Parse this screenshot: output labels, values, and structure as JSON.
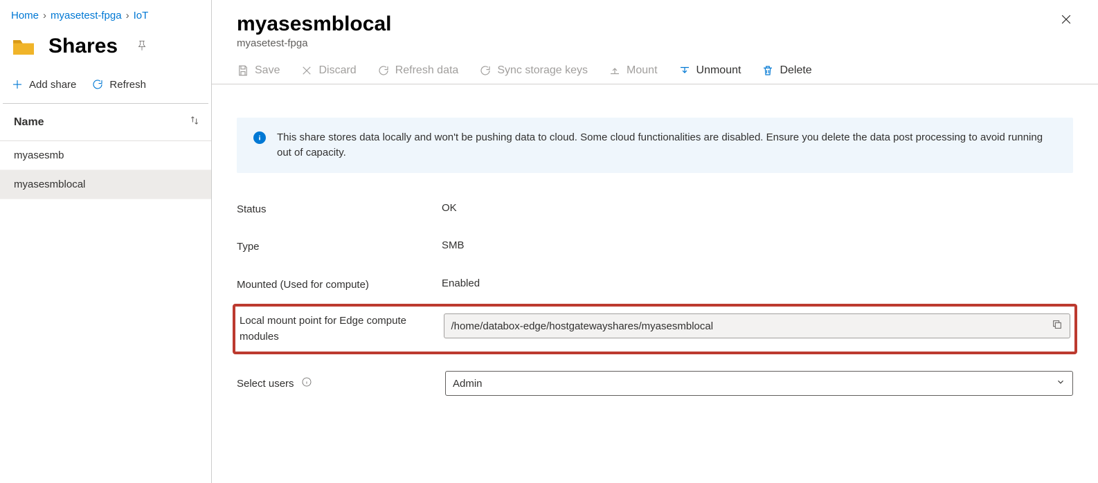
{
  "breadcrumb": {
    "home": "Home",
    "resource": "myasetest-fpga",
    "tail": "IoT"
  },
  "page": {
    "title": "Shares"
  },
  "left_toolbar": {
    "add": "Add share",
    "refresh": "Refresh"
  },
  "list": {
    "col_name": "Name",
    "rows": [
      "myasesmb",
      "myasesmblocal"
    ]
  },
  "detail": {
    "title": "myasesmblocal",
    "subtitle": "myasetest-fpga",
    "cmd": {
      "save": "Save",
      "discard": "Discard",
      "refresh": "Refresh data",
      "sync": "Sync storage keys",
      "mount": "Mount",
      "unmount": "Unmount",
      "delete": "Delete"
    },
    "info": "This share stores data locally and won't be pushing data to cloud. Some cloud functionalities are disabled. Ensure you delete the data post processing to avoid running out of capacity.",
    "props": {
      "status_label": "Status",
      "status_value": "OK",
      "type_label": "Type",
      "type_value": "SMB",
      "mounted_label": "Mounted (Used for compute)",
      "mounted_value": "Enabled",
      "mountpoint_label": "Local mount point for Edge compute modules",
      "mountpoint_value": "/home/databox-edge/hostgatewayshares/myasesmblocal",
      "selectusers_label": "Select users",
      "selectusers_value": "Admin"
    }
  }
}
